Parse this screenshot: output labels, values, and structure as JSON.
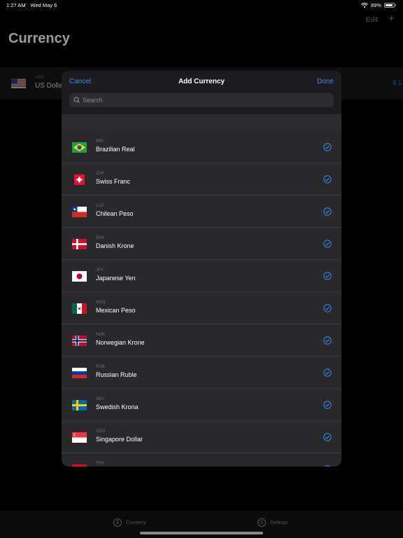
{
  "status_bar": {
    "time": "1:27 AM",
    "date": "Wed May 6",
    "battery": "89%"
  },
  "background": {
    "title": "Currency",
    "edit_label": "Edit",
    "add_label": "+",
    "row": {
      "code": "USD",
      "name": "US Dollar",
      "value": "$ 1"
    }
  },
  "tab_bar": {
    "tabs": [
      {
        "label": "Currency",
        "icon": "dollar-circle-icon"
      },
      {
        "label": "Settings",
        "icon": "settings-circle-icon"
      }
    ]
  },
  "modal": {
    "title": "Add Currency",
    "cancel_label": "Cancel",
    "done_label": "Done",
    "search_placeholder": "Search",
    "currencies": [
      {
        "code": "BRL",
        "name": "Brazilian Real",
        "flag": "brazil-flag",
        "selected": true
      },
      {
        "code": "CHF",
        "name": "Swiss Franc",
        "flag": "switzerland-flag",
        "selected": true
      },
      {
        "code": "CLP",
        "name": "Chilean Peso",
        "flag": "chile-flag",
        "selected": true
      },
      {
        "code": "DKK",
        "name": "Danish Krone",
        "flag": "denmark-flag",
        "selected": true
      },
      {
        "code": "JPY",
        "name": "Japanese Yen",
        "flag": "japan-flag",
        "selected": true
      },
      {
        "code": "MXN",
        "name": "Mexican Peso",
        "flag": "mexico-flag",
        "selected": true
      },
      {
        "code": "NOK",
        "name": "Norwegian Krone",
        "flag": "norway-flag",
        "selected": true
      },
      {
        "code": "RUB",
        "name": "Russian Ruble",
        "flag": "russia-flag",
        "selected": true
      },
      {
        "code": "SEK",
        "name": "Swedish Krona",
        "flag": "sweden-flag",
        "selected": true
      },
      {
        "code": "SGD",
        "name": "Singapore Dollar",
        "flag": "singapore-flag",
        "selected": true
      },
      {
        "code": "TRY",
        "name": "",
        "flag": "turkey-flag",
        "selected": true
      }
    ]
  },
  "colors": {
    "accent": "#3a8cf0",
    "modal_bg": "#1c1c1e",
    "row_bg": "#29292b"
  }
}
